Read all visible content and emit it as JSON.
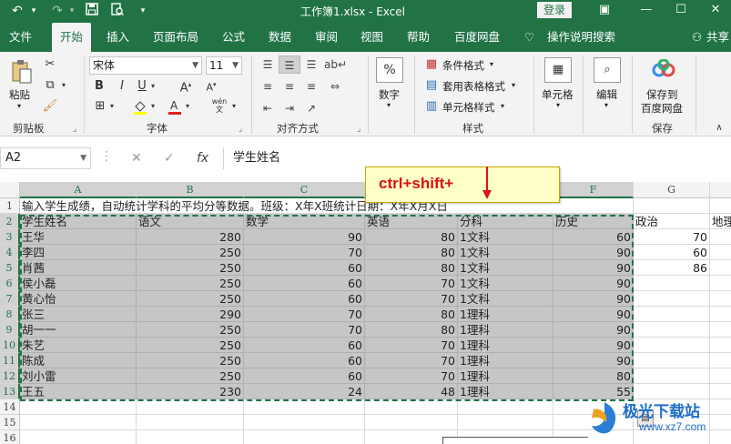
{
  "titlebar": {
    "title": "工作簿1.xlsx  -  Excel",
    "login": "登录"
  },
  "tabs": [
    "文件",
    "开始",
    "插入",
    "页面布局",
    "公式",
    "数据",
    "审阅",
    "视图",
    "帮助",
    "百度网盘",
    "操作说明搜索",
    "共享"
  ],
  "ribbon": {
    "clipboard": {
      "paste": "粘贴",
      "group": "剪贴板"
    },
    "font": {
      "name": "宋体",
      "size": "11",
      "group": "字体",
      "bold": "B",
      "italic": "I",
      "underline": "U",
      "wen": "wén"
    },
    "alignment": {
      "group": "对齐方式"
    },
    "number": {
      "label": "数字",
      "percent": "%"
    },
    "styles": {
      "conditional": "条件格式",
      "table": "套用表格格式",
      "cell": "单元格样式",
      "group": "样式"
    },
    "cells": {
      "label": "单元格"
    },
    "editing": {
      "label": "编辑"
    },
    "save": {
      "label1": "保存到",
      "label2": "百度网盘",
      "group": "保存"
    }
  },
  "formula_bar": {
    "name_box": "A2",
    "fx": "fx",
    "value": "学生姓名"
  },
  "columns": [
    "A",
    "B",
    "C",
    "D",
    "E",
    "F",
    "G"
  ],
  "rows": [
    "1",
    "2",
    "3",
    "4",
    "5",
    "6",
    "7",
    "8",
    "9",
    "10",
    "11",
    "12",
    "13",
    "14",
    "15",
    "16"
  ],
  "row1_text": "输入学生成绩，自动统计学科的平均分等数据。班级：X年X班统计日期：X年X月X日",
  "headers": [
    "学生姓名",
    "语文",
    "数学",
    "英语",
    "分科",
    "历史",
    "政治",
    "地理"
  ],
  "data_rows": [
    [
      "王华",
      "280",
      "90",
      "80",
      "1文科",
      "60",
      "70"
    ],
    [
      "李四",
      "250",
      "70",
      "80",
      "1文科",
      "90",
      "60"
    ],
    [
      "肖茜",
      "250",
      "60",
      "80",
      "1文科",
      "90",
      "86"
    ],
    [
      "侯小磊",
      "250",
      "60",
      "70",
      "1文科",
      "90",
      ""
    ],
    [
      "黄心怡",
      "250",
      "60",
      "70",
      "1文科",
      "90",
      ""
    ],
    [
      "张三",
      "290",
      "70",
      "80",
      "1理科",
      "90",
      ""
    ],
    [
      "胡一一",
      "250",
      "70",
      "80",
      "1理科",
      "90",
      ""
    ],
    [
      "朱艺",
      "250",
      "60",
      "70",
      "1理科",
      "90",
      ""
    ],
    [
      "陈成",
      "250",
      "60",
      "70",
      "1理科",
      "90",
      ""
    ],
    [
      "刘小雷",
      "250",
      "60",
      "70",
      "1理科",
      "80",
      ""
    ],
    [
      "王五",
      "230",
      "24",
      "48",
      "1理科",
      "55",
      ""
    ]
  ],
  "callout": "ctrl+shift+",
  "watermark": {
    "line1": "极光下载站",
    "line2": "www.xz7.com"
  }
}
